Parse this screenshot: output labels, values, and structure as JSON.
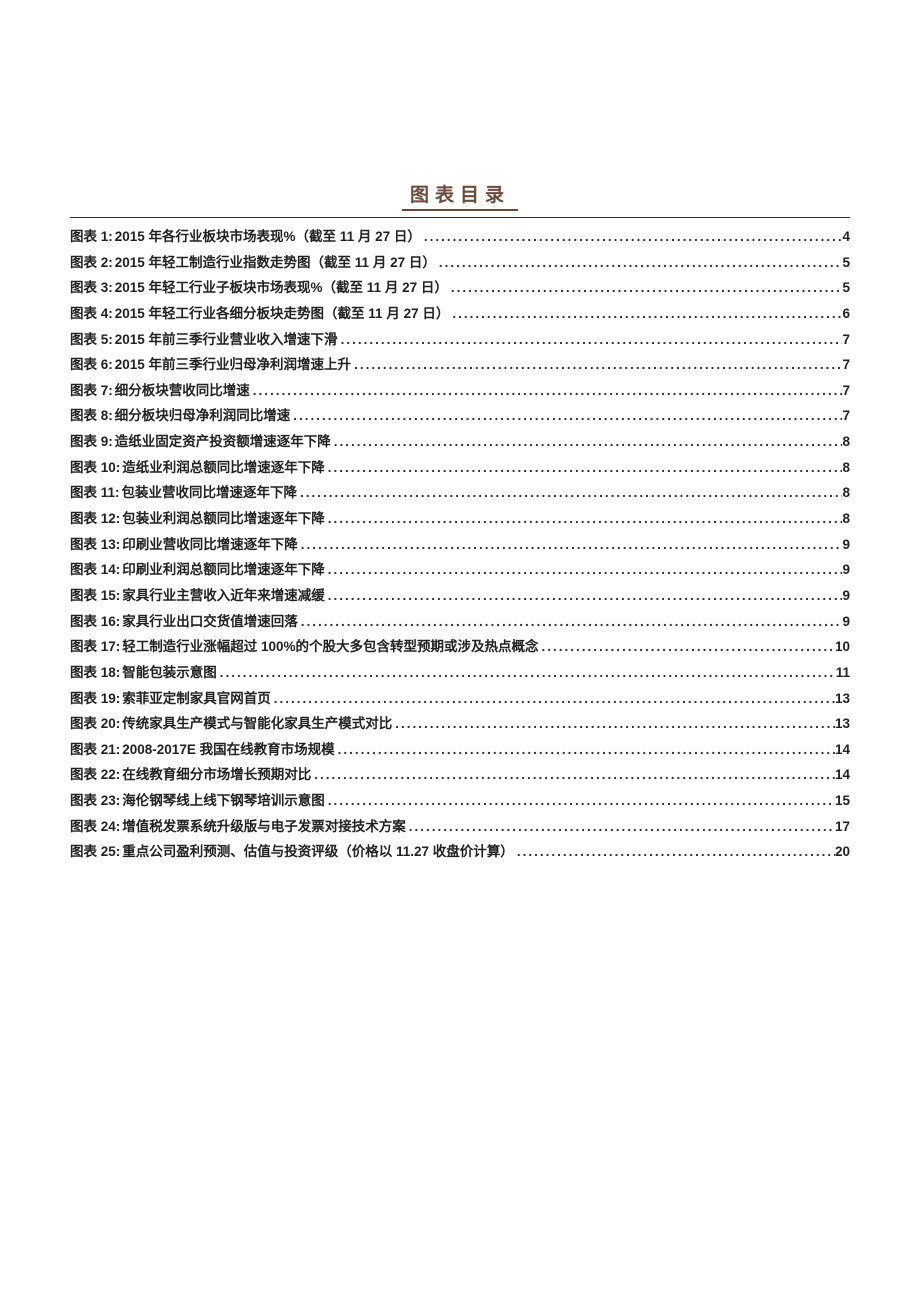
{
  "title": "图表目录",
  "entries": [
    {
      "label": "图表 1:",
      "text": "2015 年各行业板块市场表现%（截至 11 月 27 日）",
      "page": "4"
    },
    {
      "label": "图表 2:",
      "text": "2015 年轻工制造行业指数走势图（截至 11 月 27 日）",
      "page": "5"
    },
    {
      "label": "图表 3:",
      "text": "2015 年轻工行业子板块市场表现%（截至 11 月 27 日）",
      "page": "5"
    },
    {
      "label": "图表 4:",
      "text": "2015 年轻工行业各细分板块走势图（截至 11 月 27 日）",
      "page": "6"
    },
    {
      "label": "图表 5:",
      "text": "2015 年前三季行业营业收入增速下滑",
      "page": "7"
    },
    {
      "label": "图表 6:",
      "text": "2015 年前三季行业归母净利润增速上升",
      "page": "7"
    },
    {
      "label": "图表 7:",
      "text": "细分板块营收同比增速",
      "page": "7"
    },
    {
      "label": "图表 8:",
      "text": "细分板块归母净利润同比增速",
      "page": "7"
    },
    {
      "label": "图表 9:",
      "text": "造纸业固定资产投资额增速逐年下降",
      "page": "8"
    },
    {
      "label": "图表 10:",
      "text": "造纸业利润总额同比增速逐年下降",
      "page": "8"
    },
    {
      "label": "图表 11:",
      "text": "包装业营收同比增速逐年下降",
      "page": "8"
    },
    {
      "label": "图表 12:",
      "text": "包装业利润总额同比增速逐年下降",
      "page": "8"
    },
    {
      "label": "图表 13:",
      "text": "印刷业营收同比增速逐年下降",
      "page": "9"
    },
    {
      "label": "图表 14:",
      "text": "印刷业利润总额同比增速逐年下降",
      "page": "9"
    },
    {
      "label": "图表 15:",
      "text": "家具行业主营收入近年来增速减缓",
      "page": "9"
    },
    {
      "label": "图表 16:",
      "text": "家具行业出口交货值增速回落",
      "page": "9"
    },
    {
      "label": "图表 17:",
      "text": "轻工制造行业涨幅超过 100%的个股大多包含转型预期或涉及热点概念",
      "page": "10"
    },
    {
      "label": "图表 18:",
      "text": "智能包装示意图",
      "page": "11"
    },
    {
      "label": "图表 19:",
      "text": "索菲亚定制家具官网首页",
      "page": "13"
    },
    {
      "label": "图表 20:",
      "text": "传统家具生产模式与智能化家具生产模式对比",
      "page": "13"
    },
    {
      "label": "图表 21:",
      "text": "2008-2017E 我国在线教育市场规模",
      "page": "14"
    },
    {
      "label": "图表 22:",
      "text": "在线教育细分市场增长预期对比",
      "page": "14"
    },
    {
      "label": "图表 23:",
      "text": "海伦钢琴线上线下钢琴培训示意图",
      "page": "15"
    },
    {
      "label": "图表 24:",
      "text": "增值税发票系统升级版与电子发票对接技术方案",
      "page": "17"
    },
    {
      "label": "图表 25:",
      "text": "重点公司盈利预测、估值与投资评级（价格以 11.27 收盘价计算）",
      "page": "20"
    }
  ]
}
